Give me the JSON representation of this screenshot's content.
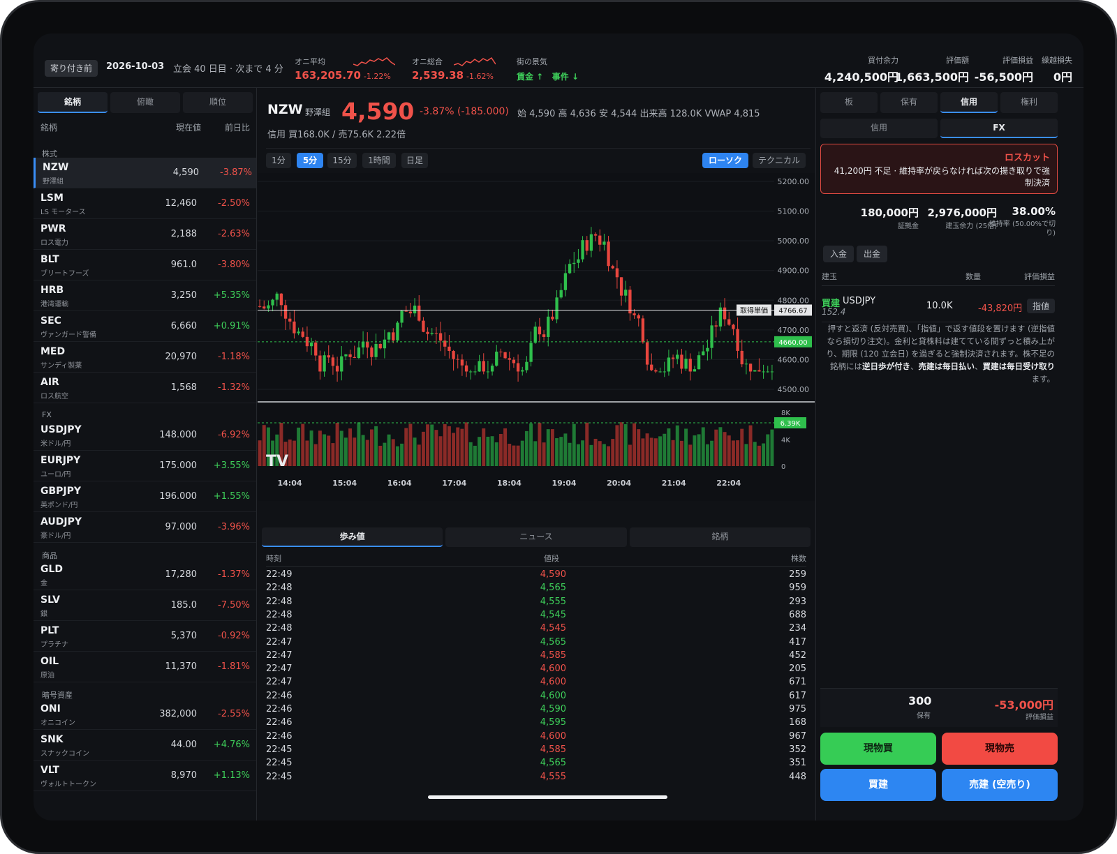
{
  "status": {
    "phase": "寄り付き前",
    "date": "2026-10-03",
    "session": "立会 40 日目 · 次まで 4 分"
  },
  "indices": [
    {
      "label": "オニ平均",
      "value": "163,205.70",
      "change": "-1.22%"
    },
    {
      "label": "オニ総合",
      "value": "2,539.38",
      "change": "-1.62%"
    }
  ],
  "mood": {
    "label": "街の景気",
    "items": [
      "賃金 ↑",
      "事件 ↓"
    ]
  },
  "account": [
    {
      "label": "買付余力",
      "value": "4,240,500円",
      "color": "#f1f2f4"
    },
    {
      "label": "評価額",
      "value": "1,663,500円",
      "color": "#f1f2f4"
    },
    {
      "label": "評価損益",
      "value": "-56,500円",
      "color": "#f0524a"
    },
    {
      "label": "繰越損失",
      "value": "0円",
      "color": "#f1f2f4"
    }
  ],
  "left": {
    "tabs": [
      "銘柄",
      "俯瞰",
      "順位"
    ],
    "columns": [
      "銘柄",
      "現在値",
      "前日比"
    ],
    "sections": [
      {
        "name": "株式",
        "rows": [
          {
            "sym": "NZW",
            "name": "野澤組",
            "price": "4,590",
            "chg": "-3.87%"
          },
          {
            "sym": "LSM",
            "name": "LS モータース",
            "price": "12,460",
            "chg": "-2.50%"
          },
          {
            "sym": "PWR",
            "name": "ロス電力",
            "price": "2,188",
            "chg": "-2.63%"
          },
          {
            "sym": "BLT",
            "name": "ブリートフーズ",
            "price": "961.0",
            "chg": "-3.80%"
          },
          {
            "sym": "HRB",
            "name": "港湾運輸",
            "price": "3,250",
            "chg": "+5.35%"
          },
          {
            "sym": "SEC",
            "name": "ヴァンガード警備",
            "price": "6,660",
            "chg": "+0.91%"
          },
          {
            "sym": "MED",
            "name": "サンディ製薬",
            "price": "20,970",
            "chg": "-1.18%"
          },
          {
            "sym": "AIR",
            "name": "ロス航空",
            "price": "1,568",
            "chg": "-1.32%"
          }
        ]
      },
      {
        "name": "FX",
        "rows": [
          {
            "sym": "USDJPY",
            "name": "米ドル/円",
            "price": "148.000",
            "chg": "-6.92%"
          },
          {
            "sym": "EURJPY",
            "name": "ユーロ/円",
            "price": "175.000",
            "chg": "+3.55%"
          },
          {
            "sym": "GBPJPY",
            "name": "英ポンド/円",
            "price": "196.000",
            "chg": "+1.55%"
          },
          {
            "sym": "AUDJPY",
            "name": "豪ドル/円",
            "price": "97.000",
            "chg": "-3.96%"
          }
        ]
      },
      {
        "name": "商品",
        "rows": [
          {
            "sym": "GLD",
            "name": "金",
            "price": "17,280",
            "chg": "-1.37%"
          },
          {
            "sym": "SLV",
            "name": "銀",
            "price": "185.0",
            "chg": "-7.50%"
          },
          {
            "sym": "PLT",
            "name": "プラチナ",
            "price": "5,370",
            "chg": "-0.92%"
          },
          {
            "sym": "OIL",
            "name": "原油",
            "price": "11,370",
            "chg": "-1.81%"
          }
        ]
      },
      {
        "name": "暗号資産",
        "rows": [
          {
            "sym": "ONI",
            "name": "オニコイン",
            "price": "382,000",
            "chg": "-2.55%"
          },
          {
            "sym": "SNK",
            "name": "スナックコイン",
            "price": "44.00",
            "chg": "+4.76%"
          },
          {
            "sym": "VLT",
            "name": "ヴォルトトークン",
            "price": "8,970",
            "chg": "+1.13%"
          }
        ]
      }
    ]
  },
  "quote": {
    "sym": "NZW",
    "name": "野澤組",
    "price": "4,590",
    "change": "-3.87% (-185.000)",
    "ohlc": "始 4,590 高 4,636 安 4,544 出来高 128.0K VWAP 4,815",
    "credit": "信用 買168.0K / 売75.6K 2.22倍"
  },
  "timeframes": [
    "1分",
    "5分",
    "15分",
    "1時間",
    "日足"
  ],
  "chart_modes": [
    "ローソク",
    "テクニカル"
  ],
  "chart_data": {
    "type": "candlestick",
    "y_ticks": [
      "5200.00",
      "5100.00",
      "5000.00",
      "4900.00",
      "4800.00",
      "4700.00",
      "4600.00",
      "4500.00"
    ],
    "ylim": [
      4500,
      5200
    ],
    "cost_label": "取得単価",
    "cost_value": "4766.67",
    "last_value": "4660.00",
    "x_ticks": [
      "14:04",
      "15:04",
      "16:04",
      "17:04",
      "18:04",
      "19:04",
      "20:04",
      "21:04",
      "22:04"
    ],
    "volume_ticks": [
      "8K",
      "4K",
      "0"
    ],
    "volume_last": "6.39K",
    "logo": "TV"
  },
  "bottom_tabs": [
    "歩み値",
    "ニュース",
    "銘柄"
  ],
  "tape": {
    "columns": [
      "時刻",
      "値段",
      "株数"
    ],
    "rows": [
      {
        "t": "22:49",
        "p": "4,590",
        "q": "259",
        "c": "#f0524a"
      },
      {
        "t": "22:48",
        "p": "4,565",
        "q": "959",
        "c": "#3ecf5a"
      },
      {
        "t": "22:48",
        "p": "4,555",
        "q": "293",
        "c": "#3ecf5a"
      },
      {
        "t": "22:48",
        "p": "4,545",
        "q": "688",
        "c": "#3ecf5a"
      },
      {
        "t": "22:48",
        "p": "4,545",
        "q": "234",
        "c": "#f0524a"
      },
      {
        "t": "22:47",
        "p": "4,565",
        "q": "417",
        "c": "#3ecf5a"
      },
      {
        "t": "22:47",
        "p": "4,585",
        "q": "452",
        "c": "#f0524a"
      },
      {
        "t": "22:47",
        "p": "4,600",
        "q": "205",
        "c": "#f0524a"
      },
      {
        "t": "22:47",
        "p": "4,600",
        "q": "671",
        "c": "#f0524a"
      },
      {
        "t": "22:46",
        "p": "4,600",
        "q": "617",
        "c": "#3ecf5a"
      },
      {
        "t": "22:46",
        "p": "4,590",
        "q": "975",
        "c": "#3ecf5a"
      },
      {
        "t": "22:46",
        "p": "4,595",
        "q": "168",
        "c": "#3ecf5a"
      },
      {
        "t": "22:46",
        "p": "4,600",
        "q": "967",
        "c": "#f0524a"
      },
      {
        "t": "22:45",
        "p": "4,585",
        "q": "352",
        "c": "#f0524a"
      },
      {
        "t": "22:45",
        "p": "4,565",
        "q": "351",
        "c": "#3ecf5a"
      },
      {
        "t": "22:45",
        "p": "4,555",
        "q": "448",
        "c": "#f0524a"
      }
    ]
  },
  "right": {
    "tabs": [
      "板",
      "保有",
      "信用",
      "権利"
    ],
    "subtabs": [
      "信用",
      "FX"
    ],
    "warning": {
      "title": "ロスカット",
      "message": "41,200円 不足 · 維持率が戻らなければ次の揚き取りで強制決済"
    },
    "kpis": [
      {
        "value": "180,000円",
        "label": "証拠金"
      },
      {
        "value": "2,976,000円",
        "label": "建玉余力 (25倍)"
      },
      {
        "value": "38.00%",
        "label": "維持率 (50.00%で切り)"
      }
    ],
    "buttons": [
      "入金",
      "出金"
    ],
    "pos_columns": [
      "建玉",
      "数量",
      "評価損益"
    ],
    "position": {
      "side": "買建",
      "sym": "USDJPY",
      "entry": "152.4",
      "qty": "10.0K",
      "pl": "-43,820円",
      "action": "指値"
    },
    "note_a": "押すと返済 (反対売買)、「指値」で返す値段を置けます (逆指値なら損切り注文)。金利と貸株料は建てている間ずっと積み上がり、期限 (120 立会日) を過ぎると強制決済されます。株不足の銘柄には",
    "note_b1": "逆日歩が付き",
    "note_c": "、",
    "note_b2": "売建は毎日払い",
    "note_d": "、",
    "note_b3": "買建は毎日受け取り",
    "note_e": "ます。",
    "holding": {
      "qty": "300",
      "qty_label": "保有",
      "pl": "-53,000円",
      "pl_label": "評価損益"
    },
    "actions": [
      "現物買",
      "現物売",
      "買建",
      "売建 (空売り)"
    ]
  }
}
